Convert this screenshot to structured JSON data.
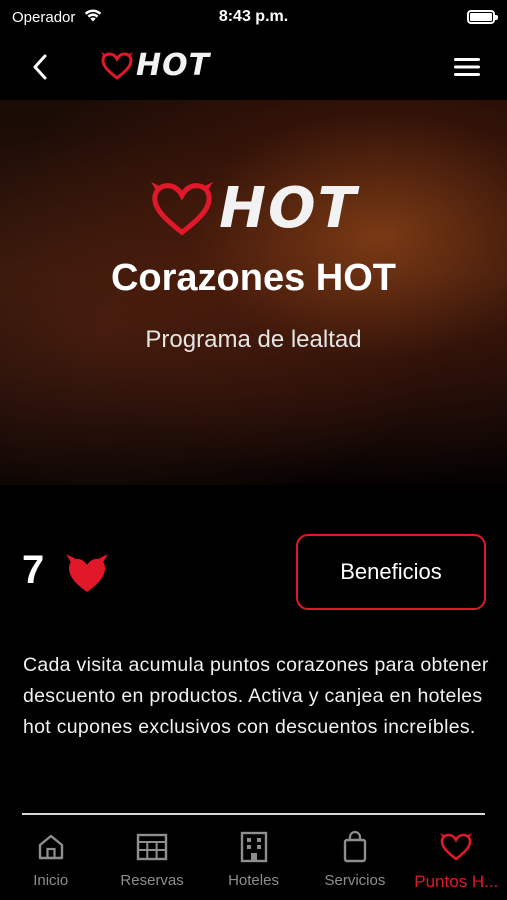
{
  "status_bar": {
    "carrier": "Operador",
    "time": "8:43 p.m.",
    "battery_level": 1.0
  },
  "nav": {
    "logo_text": "HOT",
    "back_icon": "chevron-left-icon",
    "menu_icon": "hamburger-icon"
  },
  "hero": {
    "logo_text": "HOT",
    "title": "Corazones HOT",
    "subtitle": "Programa de lealtad"
  },
  "points": {
    "value": "7",
    "icon": "devil-heart-icon"
  },
  "benefits_label": "Beneficios",
  "description": "Cada visita acumula puntos corazones para obtener descuento en productos. Activa y canjea en hoteles hot cupones exclusivos con descuentos increíbles.",
  "tabs": [
    {
      "label": "Inicio",
      "icon": "home-icon",
      "active": false
    },
    {
      "label": "Reservas",
      "icon": "calendar-grid-icon",
      "active": false
    },
    {
      "label": "Hoteles",
      "icon": "building-icon",
      "active": false
    },
    {
      "label": "Servicios",
      "icon": "shopping-bag-icon",
      "active": false
    },
    {
      "label": "Puntos H...",
      "icon": "heart-icon",
      "active": true
    }
  ],
  "colors": {
    "accent": "#e0182a",
    "background": "#000000",
    "inactive_tab": "#8e8e8e"
  }
}
